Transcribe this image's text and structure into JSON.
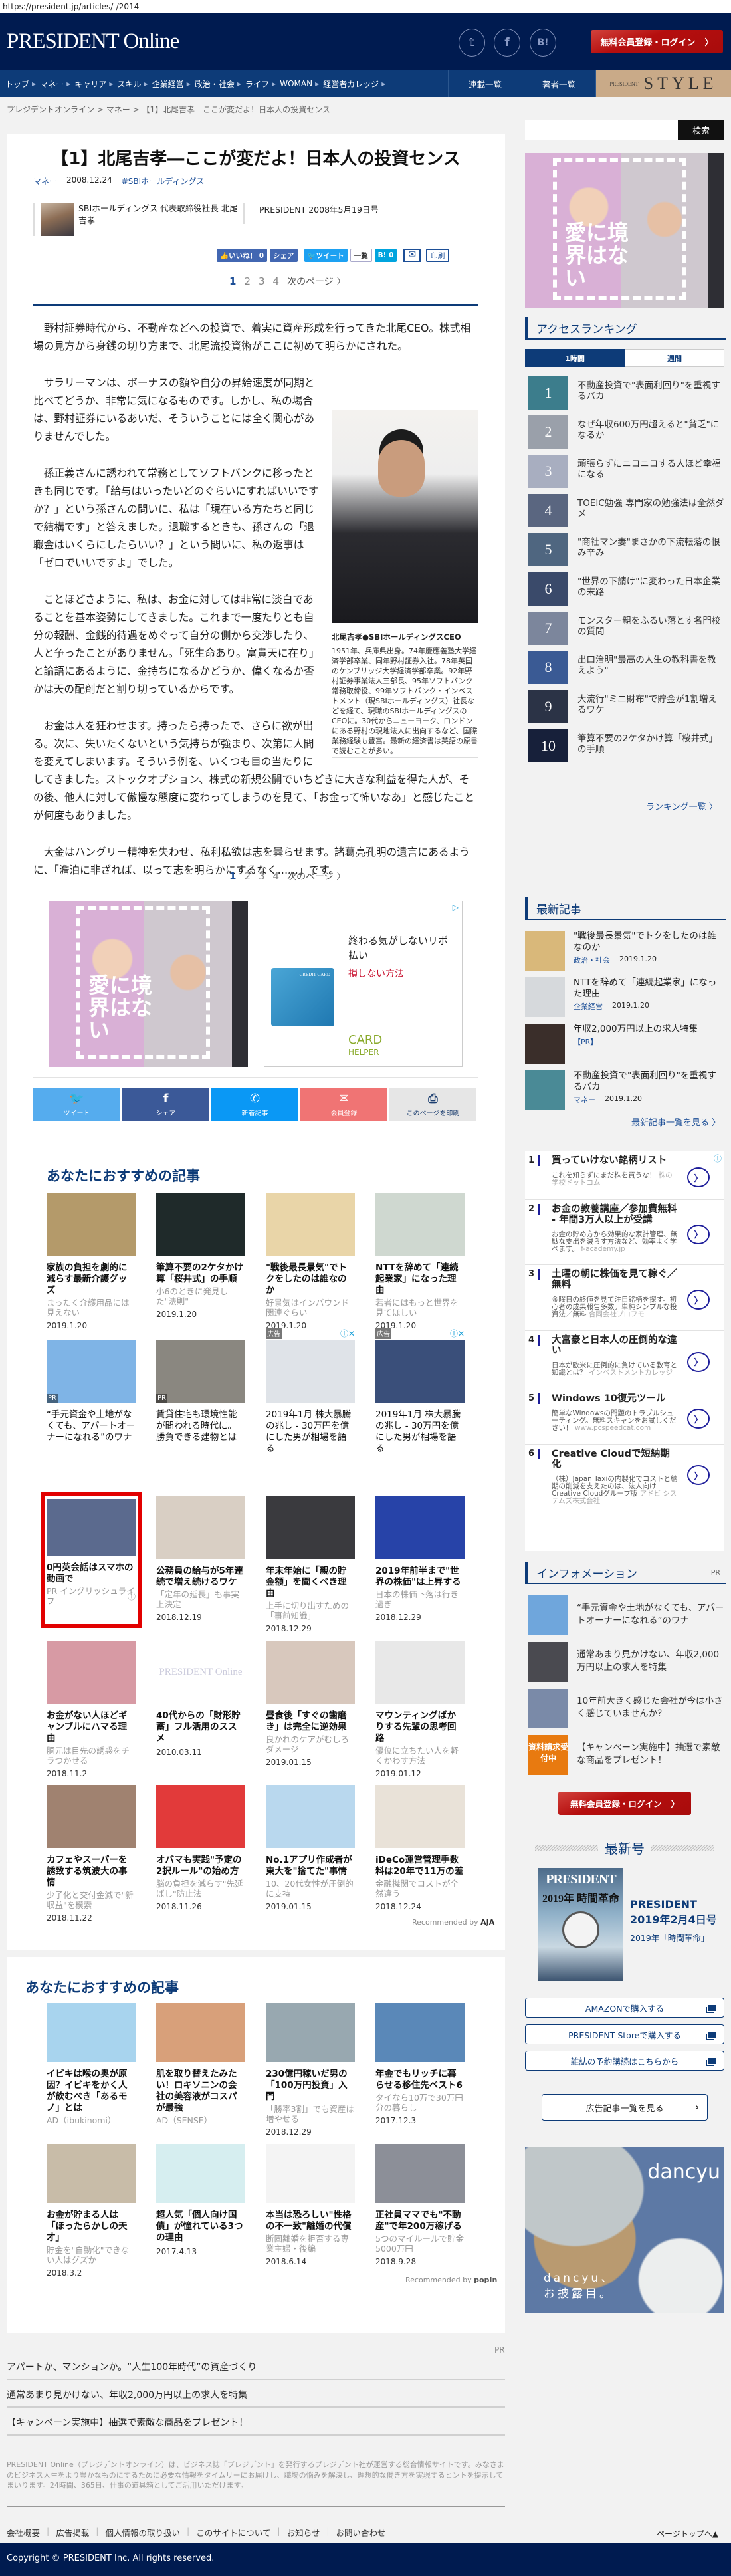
{
  "browser": {
    "url": "https://president.jp/articles/-/2014"
  },
  "header": {
    "logo": "PRESIDENT Online",
    "social": [
      "twitter",
      "facebook",
      "B!"
    ],
    "register_login": "無料会員登録・ログイン",
    "chevron": "〉"
  },
  "nav": {
    "items": [
      "トップ",
      "マネー",
      "キャリア",
      "スキル",
      "企業経営",
      "政治・社会",
      "ライフ",
      "WOMAN",
      "経営者カレッジ"
    ],
    "series": "連載一覧",
    "authors": "著者一覧",
    "style_small": "PRESIDENT",
    "style_big": "STYLE"
  },
  "breadcrumb": {
    "home": "プレジデントオンライン",
    "sep": ">",
    "category": "マネー",
    "current": "【1】北尾吉孝―ここが変だよ！日本人の投資センス"
  },
  "article": {
    "title": "【1】北尾吉孝―ここが変だよ！日本人の投資センス",
    "category": "マネー",
    "date": "2008.12.24",
    "tag": "#SBIホールディングス",
    "author": "SBIホールディングス 代表取締役社長 北尾 吉孝",
    "issue": "PRESIDENT 2008年5月19日号",
    "share": {
      "like": "いいね！ 0",
      "share": "シェア",
      "tweet": "ツイート",
      "list": "一覧",
      "hatena": "B! 0",
      "print": "印刷"
    },
    "pages": [
      "1",
      "2",
      "3",
      "4"
    ],
    "next": "次のページ 〉",
    "paragraphs": [
      "野村証券時代から、不動産などへの投資で、着実に資産形成を行ってきた北尾CEO。株式相場の見方から身銭の切り方まで、北尾流投資術がここに初めて明らかにされた。",
      "サラリーマンは、ボーナスの額や自分の昇給速度が同期と比べてどうか、非常に気になるものです。しかし、私の場合は、野村証券にいるあいだ、そういうことには全く関心がありませんでした。",
      "孫正義さんに誘われて常務としてソフトバンクに移ったときも同じです。「給与はいったいどのぐらいにすればいいですか？」という孫さんの問いに、私は「現在いる方たちと同じで結構です」と答えました。退職するときも、孫さんの「退職金はいくらにしたらいい？」という問いに、私の返事は「ゼロでいいですよ」でした。",
      "ことほどさように、私は、お金に対しては非常に淡白であることを基本姿勢にしてきました。これまで一度たりとも自分の報酬、金銭的待遇をめぐって自分の側から交渉したり、人と争ったことがありません。「死生命あり。富貴天に在り」と論語にあるように、金持ちになるかどうか、偉くなるか否かは天の配剤だと割り切っているからです。",
      "お金は人を狂わせます。持ったら持ったで、さらに欲が出る。次に、失いたくないという気持ちが強まり、次第に人間を変えてしまいます。そういう例を、いくつも目の当たりにしてきました。ストックオプション、株式の新規公開でいちどきに大きな利益を得た人が、その後、他人に対して傲慢な態度に変わってしまうのを見て、「お金って怖いなあ」と感じたことが何度もありました。",
      "大金はハングリー精神を失わせ、私利私欲は志を曇らせます。諸葛亮孔明の遺言にあるように、「澹泊に非ざれば、以って志を明らかにするなく……」です。"
    ],
    "caption_title": "北尾吉孝●SBIホールディングスCEO",
    "caption": "1951年、兵庫県出身。74年慶應義塾大学経済学部卒業、同年野村証券入社。78年英国のケンブリッジ大学経済学部卒業。92年野村証券事業法人三部長、95年ソフトバンク常務取締役、99年ソフトバンク・インベストメント（現SBIホールディングス）社長などを経て、現職のSBIホールディングスのCEOに。30代からニューヨーク、ロンドンにある野村の現地法人に出向するなど、国際業務経験も豊富。最新の経済書は英語の原書で読むことが多い。"
  },
  "ads": {
    "banner_text": "愛に境界はない",
    "card_ad": {
      "headline": "終わる気がしないリボ払い",
      "red": "損しない方法",
      "card_label": "CREDIT CARD",
      "logo1": "CARD",
      "logo2": "HELPER",
      "adchoice": "▷"
    }
  },
  "sharebar": [
    {
      "label": "ツイート",
      "icon": "twitter-icon",
      "glyph": "🐦",
      "color": "#55acee"
    },
    {
      "label": "シェア",
      "icon": "facebook-icon",
      "glyph": "f",
      "color": "#3b5998"
    },
    {
      "label": "新着記事",
      "icon": "messenger-icon",
      "glyph": "✆",
      "color": "#0a98f5"
    },
    {
      "label": "会員登録",
      "icon": "mail-icon",
      "glyph": "✉",
      "color": "#f07474"
    },
    {
      "label": "このページを印刷",
      "icon": "printer-icon",
      "glyph": "⎙",
      "color": "#e6e6e6"
    }
  ],
  "recommend1": {
    "heading": "あなたにおすすめの記事",
    "items": [
      {
        "title": "家族の負担を劇的に減らす最新介護グッズ",
        "sub": "まったく介護用品には見えない",
        "date": "2019.1.20",
        "color": "#b49a6a"
      },
      {
        "title": "筆算不要の2ケタかけ算「桜井式」の手順",
        "sub": "小6のときに発見した\"法則\"",
        "date": "2019.1.20",
        "color": "#1f2a2a"
      },
      {
        "title": "\"戦後最長景気\"でトクをしたのは誰なのか",
        "sub": "好景気はインバウンド関連ぐらい",
        "date": "2019.1.20",
        "color": "#e9d5a8"
      },
      {
        "title": "NTTを辞めて「連続起業家」になった理由",
        "sub": "若者にはもっと世界を見てほしい",
        "date": "2019.1.20",
        "color": "#cfd8d0"
      },
      {
        "title": "“手元資金や土地がなくても、アパートオーナーになれる”のワナ",
        "badge": "PR",
        "color": "#7fb4e6",
        "norm": true
      },
      {
        "title": "賃貸住宅も環境性能が問われる時代に。勝負できる建物とは",
        "badge": "PR",
        "color": "#8a8780",
        "norm": true
      },
      {
        "title": "2019年1月 株大暴騰の兆し - 30万円を億にした男が相場を語る",
        "ad": "広告",
        "color": "#dfe3e8",
        "norm": true
      },
      {
        "title": "2019年1月 株大暴騰の兆し - 30万円を億にした男が相場を語る",
        "ad": "広告",
        "color": "#3a4f7a",
        "norm": true
      },
      {
        "title": "0円英会話はスマホの動画で",
        "sub": "PR イングリッシュライフ",
        "color": "#5b6a8e",
        "red": true
      },
      {
        "title": "公務員の給与が5年連続で増え続けるワケ",
        "sub": "「定年の延長」も事実上決定",
        "date": "2018.12.19",
        "color": "#d9cfc4"
      },
      {
        "title": "年末年始に「親の貯金額」を聞くべき理由",
        "sub": "上手に切り出すための「事前知識」",
        "date": "2018.12.29",
        "color": "#3a3a3e"
      },
      {
        "title": "2019年前半まで\"世界の株価\"は上昇する",
        "sub": "日本の株価下落は行き過ぎ",
        "date": "2018.12.29",
        "color": "#2743a8"
      },
      {
        "title": "お金がない人ほどギャンブルにハマる理由",
        "sub": "胴元は目先の誘惑をチラつかせる",
        "date": "2018.11.2",
        "color": "#d79aa4"
      },
      {
        "title": "40代からの「財形貯蓄」フル活用のススメ",
        "date": "2010.03.11",
        "color": "#ffffff",
        "placeholder": "PRESIDENT Online"
      },
      {
        "title": "昼食後「すぐの歯磨き」は完全に逆効果",
        "sub": "良かれのケアがむしろダメージ",
        "date": "2019.01.15",
        "color": "#d8c8bd"
      },
      {
        "title": "マウンティングばかりする先輩の思考回路",
        "sub": "優位に立ちたい人を軽くかわす方法",
        "date": "2019.01.12",
        "color": "#e8e8e8"
      },
      {
        "title": "カフェやスーパーを誘致する筑波大の事情",
        "sub": "少子化と交付金減で\"新収益\"を模索",
        "date": "2018.11.22",
        "color": "#a08270"
      },
      {
        "title": "オバマも実践\"予定の2択ルール\"の始め方",
        "sub": "脳の負担を減らす\"先延ばし\"防止法",
        "date": "2018.11.26",
        "color": "#e23a3a"
      },
      {
        "title": "No.1アプリ作成者が東大を\"捨てた\"事情",
        "sub": "10、20代女性が圧倒的に支持",
        "date": "2019.01.15",
        "color": "#b9d8ee"
      },
      {
        "title": "iDeCo運営管理手数料は20年で11万の差",
        "sub": "金融機関でコストが全然違う",
        "date": "2018.12.24",
        "color": "#e9e2d8"
      }
    ],
    "recommended_by": "Recommended by",
    "provider": "AJA"
  },
  "recommend2": {
    "heading": "あなたにおすすめの記事",
    "items": [
      {
        "title": "イビキは喉の奥が原因？イビキをかく人が飲むべき「あるモノ」とは",
        "sub": "AD（ibukinomi）",
        "color": "#a8d4ee"
      },
      {
        "title": "肌を取り替えたみたい！ロキソニンの会社の美容液がコスパが最強",
        "sub": "AD（SENSE）",
        "color": "#d8a07a"
      },
      {
        "title": "230億円稼いだ男の「100万円投資」入門",
        "sub": "「勝率3割」でも資産は増やせる",
        "date": "2018.12.29",
        "color": "#98a8b0"
      },
      {
        "title": "年金でもリッチに暮らせる移住先ベスト6",
        "sub": "タイなら10万で30万円分の暮らし",
        "date": "2017.12.3",
        "color": "#5a88b8"
      },
      {
        "title": "お金が貯まる人は「ほったらかしの天才」",
        "sub": "貯金を\"自動化\"できない人はグズか",
        "date": "2018.3.2",
        "color": "#c8bca8"
      },
      {
        "title": "超人気「個人向け国債」が憧れている3つの理由",
        "date": "2017.4.13",
        "color": "#d6eef0"
      },
      {
        "title": "本当は恐ろしい\"性格の不一致\"離婚の代償",
        "sub": "断固離婚を拒否する専業主婦・後編",
        "date": "2018.6.14",
        "color": "#f4f4f4"
      },
      {
        "title": "正社員ママでも\"不動産\"で年200万稼げる",
        "sub": "5つのマイルールで貯金5000万円",
        "date": "2018.9.28",
        "color": "#8c8f98"
      }
    ],
    "recommended_by": "Recommended by",
    "provider": "popIn"
  },
  "pr_links": {
    "label": "PR",
    "items": [
      "アパートか、マンションか。“人生100年時代”の資産づくり",
      "通常あまり見かけない、年収2,000万円以上の求人を特集",
      "【キャンペーン実施中】抽選で素敵な商品をプレゼント！"
    ]
  },
  "footer": {
    "description": "PRESIDENT Online（プレジデントオンライン）は、ビジネス誌「プレジデント」を発行するプレジデント社が運営する総合情報サイトです。みなさまのビジネス人生をより豊かなものにするために必要な情報をタイムリーにお届けし、職場の悩みを解決し、理想的な働き方を実現するヒントを提示してまいります。24時間、365日、仕事の道具箱としてご活用いただけます。",
    "links": [
      "会社概要",
      "広告掲載",
      "個人情報の取り扱い",
      "このサイトについて",
      "お知らせ",
      "お問い合わせ"
    ],
    "sep": "|",
    "page_top": "ページトップへ▲",
    "copyright": "Copyright © PRESIDENT Inc. All rights reserved."
  },
  "sidebar": {
    "search_button": "検索",
    "ranking": {
      "heading": "アクセスランキング",
      "tabs": [
        "1時間",
        "週間"
      ],
      "items": [
        {
          "rank": "1",
          "title": "不動産投資で\"表面利回り\"を重視するバカ",
          "color": "#3c7d8c"
        },
        {
          "rank": "2",
          "title": "なぜ年収600万円超えると\"貧乏\"になるか",
          "color": "#9aa0aa"
        },
        {
          "rank": "3",
          "title": "頑張らずにニコニコする人ほど幸福になる",
          "color": "#a8aec0"
        },
        {
          "rank": "4",
          "title": "TOEIC勉強 専門家の勉強法は全然ダメ",
          "color": "#5a6680"
        },
        {
          "rank": "5",
          "title": "\"商社マン妻\"まさかの下流転落の恨み辛み",
          "color": "#4f6680"
        },
        {
          "rank": "6",
          "title": "\"世界の下請け\"に変わった日本企業の末路",
          "color": "#3a4a6a"
        },
        {
          "rank": "7",
          "title": "モンスター親をふるい落とす名門校の質問",
          "color": "#7c869c"
        },
        {
          "rank": "8",
          "title": "出口治明\"最高の人生の教科書を教えよう\"",
          "color": "#3a5a94"
        },
        {
          "rank": "9",
          "title": "大流行\"ミニ財布\"で貯金が1割増えるワケ",
          "color": "#2b3346"
        },
        {
          "rank": "10",
          "title": "筆算不要の2ケタかけ算「桜井式」の手順",
          "color": "#17203a"
        }
      ],
      "more": "ランキング一覧 〉"
    },
    "latest": {
      "heading": "最新記事",
      "items": [
        {
          "title": "\"戦後最長景気\"でトクをしたのは誰なのか",
          "category": "政治・社会",
          "date": "2019.1.20",
          "color": "#d9b87a"
        },
        {
          "title": "NTTを辞めて「連続起業家」になった理由",
          "category": "企業経営",
          "date": "2019.1.20",
          "color": "#d6d9dc"
        },
        {
          "title": "年収2,000万円以上の求人特集",
          "category": "【PR】",
          "date": "",
          "color": "#3a2e2a"
        },
        {
          "title": "不動産投資で\"表面利回り\"を重視するバカ",
          "category": "マネー",
          "date": "2019.1.20",
          "color": "#4a8a96"
        }
      ],
      "more": "最新記事一覧を見る 〉"
    },
    "adlist": {
      "info": "ⓘ",
      "items": [
        {
          "n": "1",
          "h": "買っていけない銘柄リスト",
          "d": "これを知らずにまだ株を買うな！",
          "u": "株の学校ドットコム"
        },
        {
          "n": "2",
          "h": "お金の教養講座／参加費無料 - 年間3万人以上が受講",
          "d": "お金の貯め方から効果的な家計管理、無駄な支出を減らす方法など、効率よく学べます。",
          "u": "f-academy.jp"
        },
        {
          "n": "3",
          "h": "土曜の朝に株価を見て稼ぐ／無料",
          "d": "金曜日の終値を見て注目銘柄を探す。初心者の成果報告多数。単純シンプルな投資法／無料",
          "u": "合同会社プロフモ"
        },
        {
          "n": "4",
          "h": "大富豪と日本人の圧倒的な違い",
          "d": "日本が欧米に圧倒的に負けている教育と知識とは？",
          "u": "インベストメントカレッジ"
        },
        {
          "n": "5",
          "h": "Windows 10復元ツール",
          "d": "簡単なWindowsの問題のトラブルシューティング。無料スキャンをお試しください！",
          "u": "www.pcspeedcat.com"
        },
        {
          "n": "6",
          "h": "Creative Cloudで短納期化",
          "d": "（株）Japan Taxiの内製化でコストと納期の削減を支えたのは、法人向けCreative Cloudグループ版",
          "u": "アドビ システムズ株式会社"
        }
      ]
    },
    "information": {
      "heading": "インフォメーション",
      "pr": "PR",
      "items": [
        {
          "title": "“手元資金や土地がなくても、アパートオーナーになれる”のワナ",
          "color": "#6fa6dc"
        },
        {
          "title": "通常あまり見かけない、年収2,000万円以上の求人を特集",
          "color": "#4a4a50"
        },
        {
          "title": "10年前大きく感じた会社が今は小さく感じていませんか？",
          "color": "#7a8aa8"
        },
        {
          "title": "【キャンペーン実施中】抽選で素敵な商品をプレゼント！",
          "color": "#e87a10",
          "thumb_text": "資料請求受付中"
        }
      ]
    },
    "register_login": "無料会員登録・ログイン",
    "latest_issue": {
      "heading": "最新号",
      "cover_logo": "PRESIDENT",
      "cover_title": "2019年 時間革命",
      "title": "PRESIDENT 2019年2月4日号",
      "subtitle": "2019年「時間革命」",
      "buttons": [
        "AMAZONで購入する",
        "PRESIDENT Storeで購入する",
        "雑誌の予約購読はこちらから"
      ]
    },
    "ads_list_button": "広告記事一覧を見る",
    "dancyu": {
      "logo": "dancyu",
      "copy": "dancyu、お披露目。"
    }
  }
}
